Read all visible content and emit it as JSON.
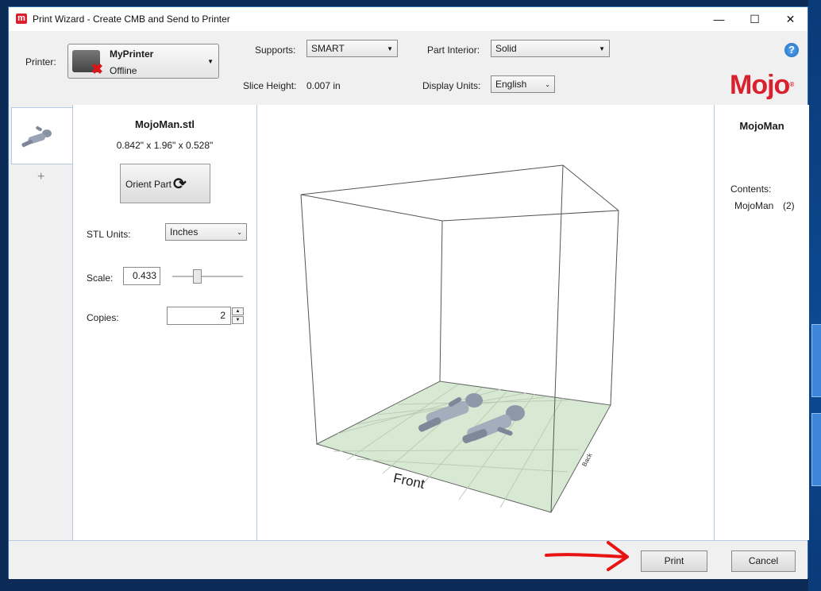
{
  "window": {
    "title": "Print Wizard - Create CMB and Send to Printer",
    "app_icon_letter": "m",
    "minimize_glyph": "—",
    "maximize_glyph": "☐",
    "close_glyph": "✕"
  },
  "header": {
    "printer_label": "Printer:",
    "printer_name": "MyPrinter",
    "printer_status": "Offline",
    "printer_status_icon": "red-x-icon",
    "supports_label": "Supports:",
    "supports_value": "SMART",
    "part_interior_label": "Part Interior:",
    "part_interior_value": "Solid",
    "slice_height_label": "Slice Height:",
    "slice_height_value": "0.007 in",
    "display_units_label": "Display Units:",
    "display_units_value": "English",
    "help_glyph": "?",
    "logo_text": "Mojo"
  },
  "tabs": {
    "add_glyph": "+"
  },
  "part_panel": {
    "file_name": "MojoMan.stl",
    "dimensions": "0.842\" x 1.96\" x 0.528\"",
    "orient_button_label": "Orient Part",
    "stl_units_label": "STL Units:",
    "stl_units_value": "Inches",
    "scale_label": "Scale:",
    "scale_value": "0.433",
    "copies_label": "Copies:",
    "copies_value": "2"
  },
  "viewport": {
    "front_label": "Front",
    "side_label": "Back"
  },
  "contents_panel": {
    "title": "MojoMan",
    "contents_label": "Contents:",
    "item_name": "MojoMan",
    "item_count": "(2)"
  },
  "footer": {
    "print_label": "Print",
    "cancel_label": "Cancel"
  },
  "colors": {
    "brand_red": "#d9212d",
    "platform_green": "#d8e9d3",
    "annotation_arrow": "#e81313"
  }
}
